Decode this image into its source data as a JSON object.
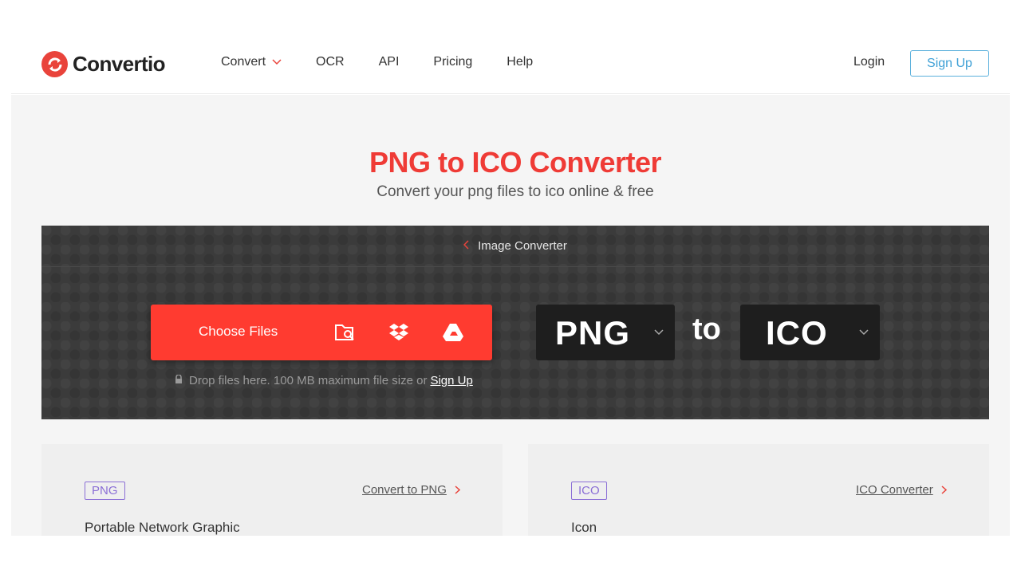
{
  "brand": {
    "name": "Convertio",
    "accent": "#e9433b"
  },
  "nav": {
    "items": [
      {
        "label": "Convert",
        "has_dropdown": true
      },
      {
        "label": "OCR"
      },
      {
        "label": "API"
      },
      {
        "label": "Pricing"
      },
      {
        "label": "Help"
      }
    ],
    "login_label": "Login",
    "signup_label": "Sign Up"
  },
  "hero": {
    "title": "PNG to ICO Converter",
    "subtitle": "Convert your png files to ico online & free"
  },
  "converter": {
    "breadcrumb": "Image Converter",
    "choose_label": "Choose Files",
    "icons": [
      "folder-search-icon",
      "dropbox-icon",
      "google-drive-icon"
    ],
    "hint_text": "Drop files here. 100 MB maximum file size or",
    "hint_link": "Sign Up",
    "from_format": "PNG",
    "to_word": "to",
    "to_format": "ICO"
  },
  "cards": [
    {
      "tag": "PNG",
      "link": "Convert to PNG",
      "description": "Portable Network Graphic"
    },
    {
      "tag": "ICO",
      "link": "ICO Converter",
      "description": "Icon"
    }
  ]
}
